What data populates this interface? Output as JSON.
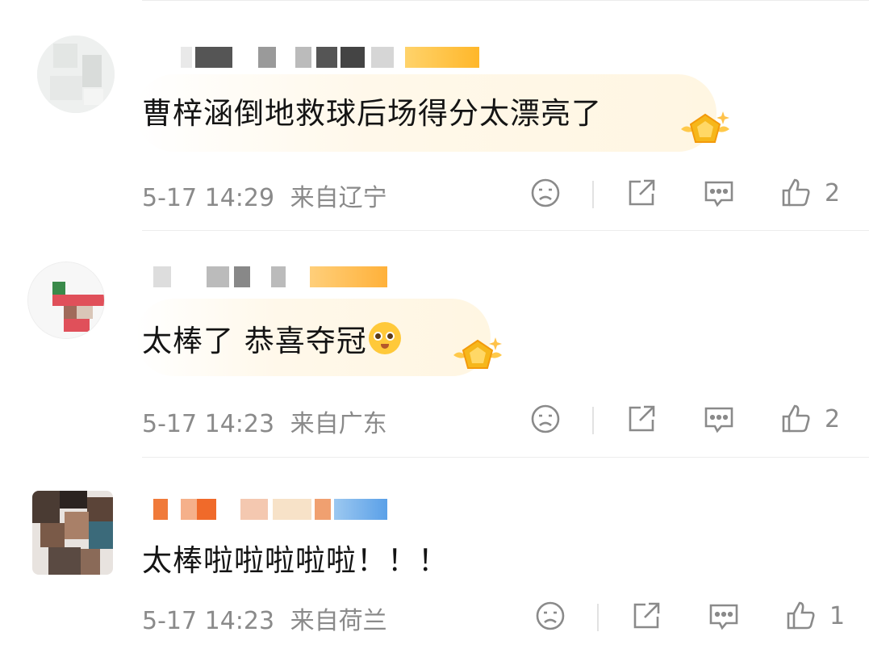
{
  "comments": [
    {
      "text": "曹梓涵倒地救球后场得分太漂亮了",
      "emoji": "",
      "date": "5-17 14:29",
      "location": "来自辽宁",
      "likes": "2",
      "has_badge": true
    },
    {
      "text": "太棒了 恭喜夺冠",
      "emoji": "pleading-face",
      "date": "5-17 14:23",
      "location": "来自广东",
      "likes": "2",
      "has_badge": true
    },
    {
      "text": "太棒啦啦啦啦啦！！！",
      "emoji": "",
      "date": "5-17 14:23",
      "location": "来自荷兰",
      "likes": "1",
      "has_badge": false
    }
  ],
  "icons": {
    "dislike": "sad-face-icon",
    "share": "share-icon",
    "reply": "comment-icon",
    "like": "thumbs-up-icon"
  },
  "colors": {
    "text": "#141414",
    "meta": "#8a8a8a",
    "badge_gold": "#f6b71b",
    "bubble": "#fff6e2"
  }
}
